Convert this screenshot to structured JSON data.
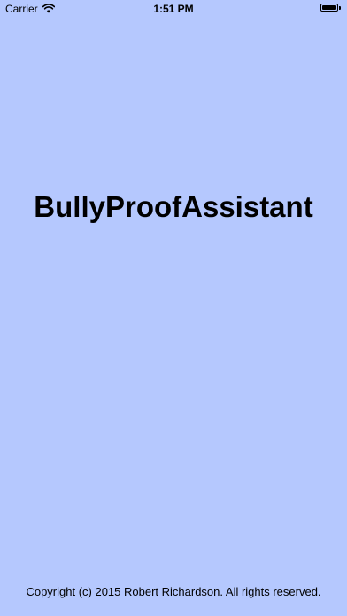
{
  "theme": {
    "background": "#b5c8fe"
  },
  "status_bar": {
    "carrier": "Carrier",
    "time": "1:51 PM",
    "wifi_icon": "wifi-icon",
    "battery_icon": "battery-icon",
    "battery_level": 1.0
  },
  "main": {
    "title": "BullyProofAssistant"
  },
  "footer": {
    "copyright": "Copyright (c) 2015 Robert Richardson. All rights reserved."
  }
}
